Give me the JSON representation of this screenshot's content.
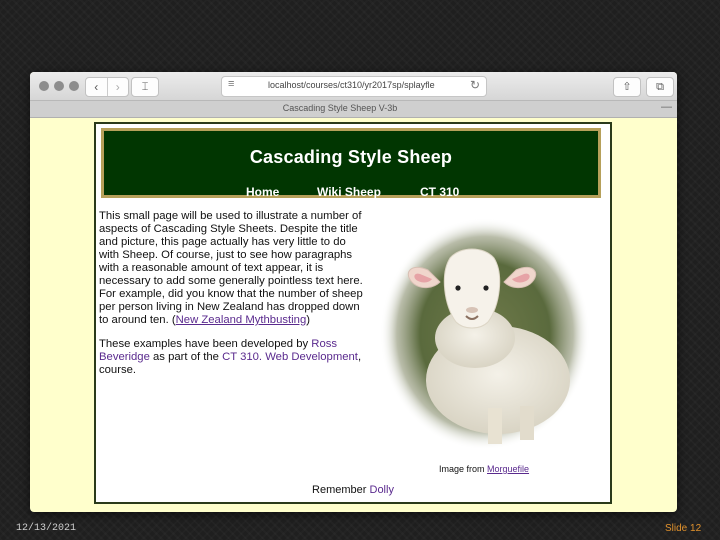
{
  "browser": {
    "url": "localhost/courses/ct310/yr2017sp/splayfle",
    "tab_title": "Cascading Style Sheep V-3b",
    "menu_glyph": "≡",
    "reload_glyph": "↻",
    "back_glyph": "‹",
    "forward_glyph": "›",
    "sidebar_glyph": "⌶",
    "share_glyph": "⇧",
    "tabs_glyph": "⧉",
    "newtab_glyph": "—"
  },
  "page": {
    "title": "Cascading Style Sheep",
    "nav": [
      "Home",
      "Wiki Sheep",
      "CT 310"
    ],
    "para1": "This small page will be used to illustrate a number of aspects of Cascading Style Sheets. Despite the title and picture, this page actually has very little to do with Sheep. Of course, just to see how paragraphs with a reasonable amount of text appear, it is necessary to add some generally pointless text here. For example, did you know that the number of sheep per person living in New Zealand has dropped down to around ten. (",
    "para1_link": "New Zealand Mythbusting",
    "para1_end": ")",
    "para2_start": "These examples have been developed by ",
    "para2_author": "Ross Beveridge",
    "para2_mid": " as part of the ",
    "para2_course": "CT 310. Web Development",
    "para2_end": ", course.",
    "credit_text": "Image from ",
    "credit_link": "Morguefile",
    "footer_text": "Remember ",
    "footer_link": "Dolly"
  },
  "slide": {
    "date": "12/13/2021",
    "number": "Slide 12"
  },
  "colors": {
    "banner_bg": "#013601",
    "banner_border": "#b6a05a",
    "window_bg": "#ffffcc",
    "link": "#5a2a8e",
    "slide_number": "#e0912c"
  }
}
